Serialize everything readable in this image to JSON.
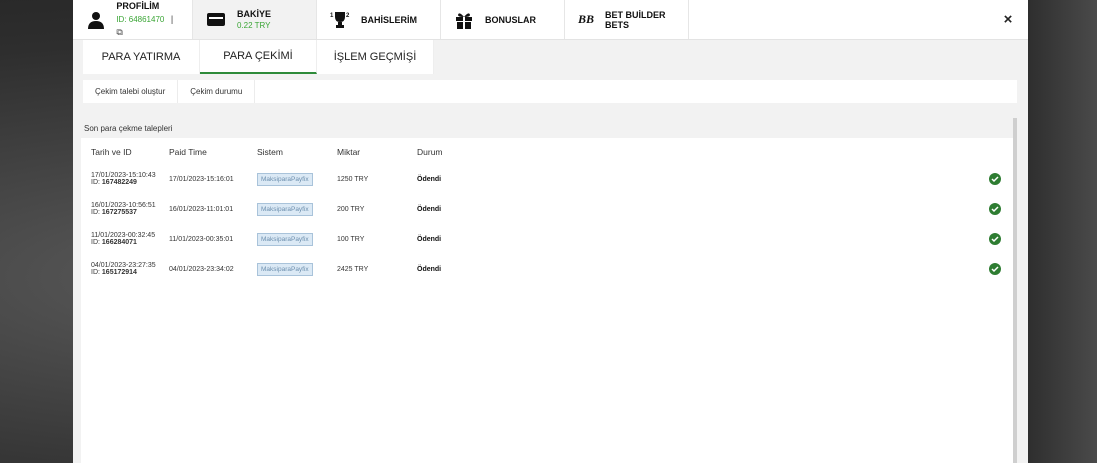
{
  "topbar": {
    "profile": {
      "title": "PROFİLİM",
      "id_text": "ID: 64861470",
      "icon": "user-icon"
    },
    "balance": {
      "title": "BAKİYE",
      "amount": "0.22 TRY",
      "icon": "card-icon"
    },
    "bets": {
      "title": "BAHİSLERİM",
      "icon": "trophy-icon"
    },
    "bonus": {
      "title": "BONUSLAR",
      "icon": "gift-icon"
    },
    "bb": {
      "title": "BET BUİLDER BETS",
      "icon": "bb-logo"
    },
    "close": "×"
  },
  "main_tabs": [
    {
      "label": "PARA YATIRMA",
      "active": false
    },
    {
      "label": "PARA ÇEKİMİ",
      "active": true
    },
    {
      "label": "İŞLEM GEÇMİŞİ",
      "active": false
    }
  ],
  "sub_tabs": [
    {
      "label": "Çekim talebi oluştur"
    },
    {
      "label": "Çekim durumu"
    }
  ],
  "panel": {
    "title": "Son para çekme talepleri",
    "columns": [
      "Tarih ve ID",
      "Paid Time",
      "Sistem",
      "Miktar",
      "Durum"
    ],
    "rows": [
      {
        "date": "17/01/2023-15:10:43",
        "id_label": "ID:",
        "id": "167482249",
        "paid": "17/01/2023-15:16:01",
        "system": "MaksiparaPayfix",
        "amount": "1250 TRY",
        "status": "Ödendi"
      },
      {
        "date": "16/01/2023-10:56:51",
        "id_label": "ID:",
        "id": "167275537",
        "paid": "16/01/2023-11:01:01",
        "system": "MaksiparaPayfix",
        "amount": "200 TRY",
        "status": "Ödendi"
      },
      {
        "date": "11/01/2023-00:32:45",
        "id_label": "ID:",
        "id": "166284071",
        "paid": "11/01/2023-00:35:01",
        "system": "MaksiparaPayfix",
        "amount": "100 TRY",
        "status": "Ödendi"
      },
      {
        "date": "04/01/2023-23:27:35",
        "id_label": "ID:",
        "id": "165172914",
        "paid": "04/01/2023-23:34:02",
        "system": "MaksiparaPayfix",
        "amount": "2425 TRY",
        "status": "Ödendi"
      }
    ]
  },
  "colors": {
    "accent": "#2e8b3a",
    "balance_green": "#3aa535",
    "check": "#2e7d32"
  }
}
